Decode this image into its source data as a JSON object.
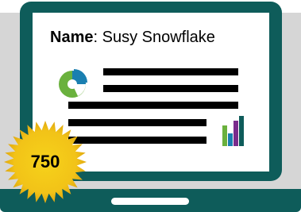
{
  "profile": {
    "name_label": "Name",
    "name_separator": ": ",
    "name_value": "Susy Snowflake"
  },
  "score_badge": {
    "value": "750",
    "color": "#f6d21a"
  },
  "colors": {
    "laptop": "#0e5c5a",
    "pie_main": "#6ab13d",
    "pie_slice": "#1a7fb0",
    "bar_1": "#6ab13d",
    "bar_2": "#1a7fb0",
    "bar_3": "#7a2b8c",
    "bar_4": "#0e5c5a"
  },
  "icons": {
    "pie": "pie-chart-icon",
    "bars": "bar-chart-icon"
  }
}
